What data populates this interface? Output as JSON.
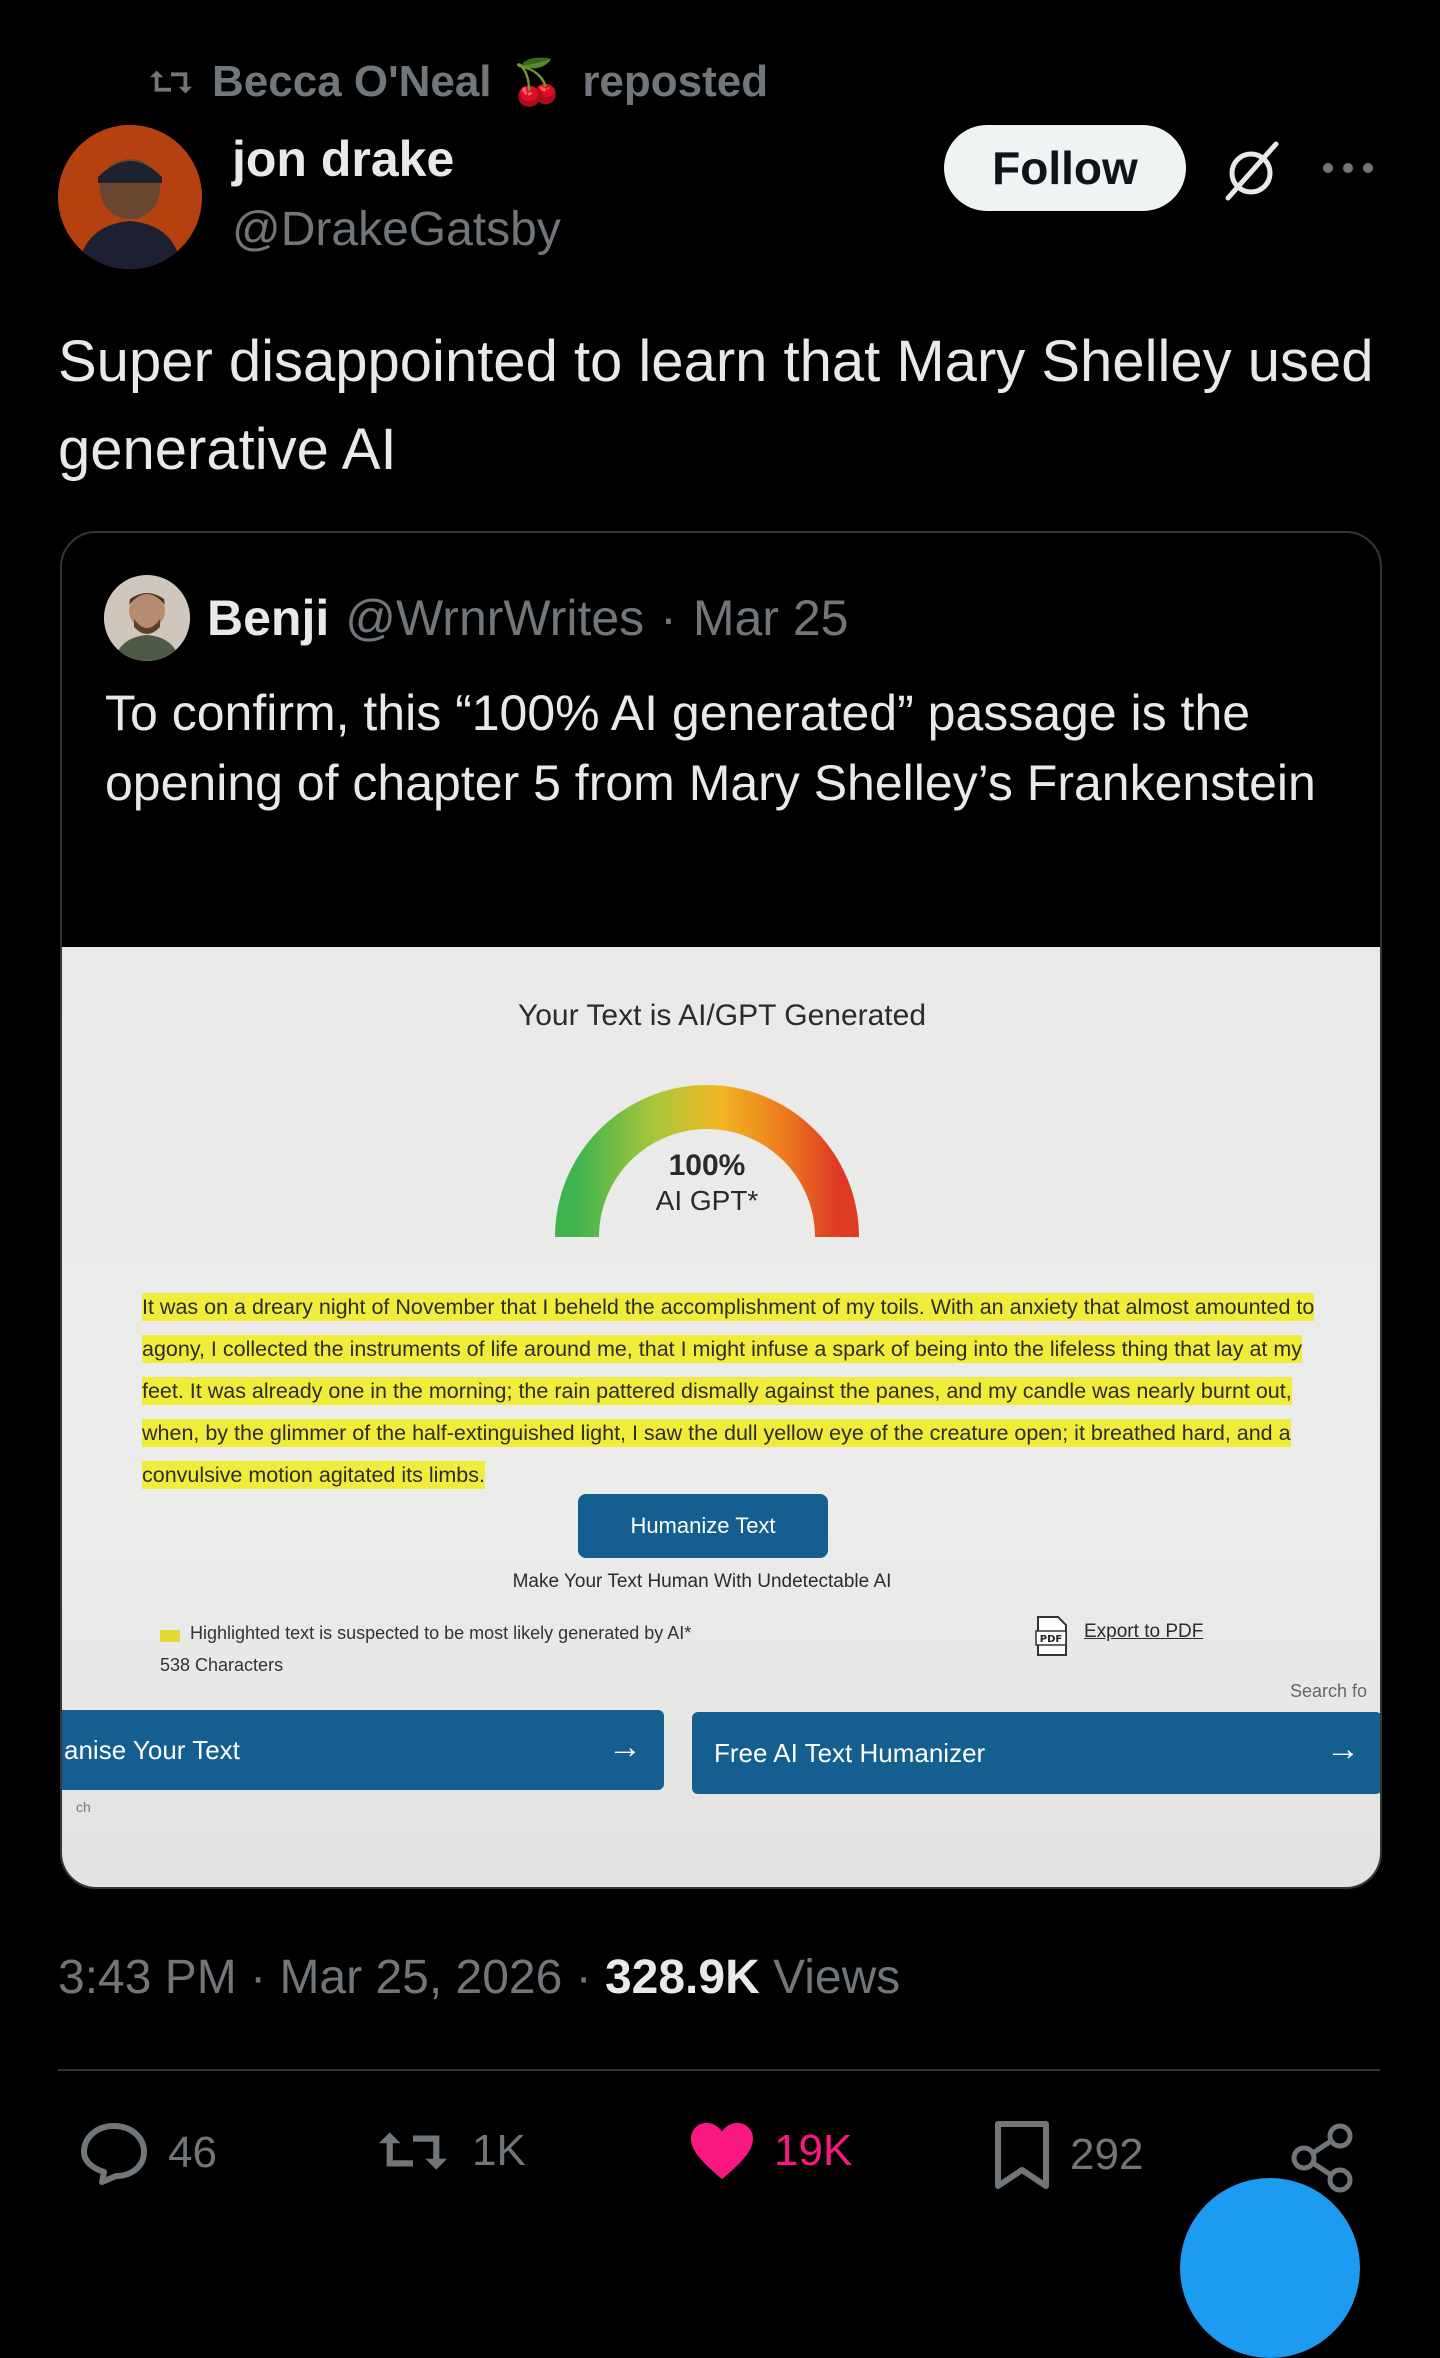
{
  "repost": {
    "user": "Becca O'Neal",
    "emoji": "🍒",
    "label": "reposted"
  },
  "author": {
    "name": "jon drake",
    "handle": "@DrakeGatsby"
  },
  "follow_label": "Follow",
  "post_text": "Super disappointed to learn that Mary Shelley used generative AI",
  "quoted": {
    "name": "Benji",
    "handle": "@WrnrWrites",
    "separator": "·",
    "date": "Mar 25",
    "text": "To confirm, this “100% AI generated” passage is the opening of chapter 5 from Mary Shelley’s Frankenstein",
    "photo": {
      "title": "Your Text is AI/GPT Generated",
      "gauge_percent": "100%",
      "gauge_label": "AI GPT*",
      "gauge_value": 1.0,
      "passage": "It was on a dreary night of November that I beheld the accomplishment of my toils. With an anxiety that almost amounted to agony, I collected the instruments of life around me, that I might infuse a spark of being into the lifeless thing that lay at my feet. It was already one in the morning; the rain pattered dismally against the panes, and my candle was nearly burnt out, when, by the glimmer of the half-extinguished light, I saw the dull yellow eye of the creature open; it breathed hard, and a convulsive motion agitated its limbs.",
      "humanize_button": "Humanize Text",
      "humanize_sub": "Make Your Text Human With Undetectable AI",
      "legend": "Highlighted text is suspected to be most likely generated by AI*",
      "char_count": "538 Characters",
      "export_label": "Export to PDF",
      "pdf_icon_label": "PDF",
      "search_partial": "Search fo",
      "banner_left": "anise Your Text",
      "banner_right": "Free AI Text Humanizer",
      "arrow": "→",
      "partial_text": "ch",
      "highlight_color": "#f0ec3a",
      "button_color": "#145f8f"
    }
  },
  "timestamp": {
    "time": "3:43 PM",
    "sep1": "·",
    "date": "Mar 25, 2026",
    "sep2": "·",
    "views_count": "328.9K",
    "views_label": "Views"
  },
  "actions": {
    "replies": "46",
    "reposts": "1K",
    "likes": "19K",
    "bookmarks": "292"
  },
  "colors": {
    "like": "#f91880",
    "accent": "#1d9bf0",
    "muted": "#71767b"
  },
  "icons": [
    "repost-icon",
    "grok-icon",
    "more-icon",
    "reply-icon",
    "heart-icon",
    "bookmark-icon",
    "share-icon",
    "pdf-icon"
  ]
}
